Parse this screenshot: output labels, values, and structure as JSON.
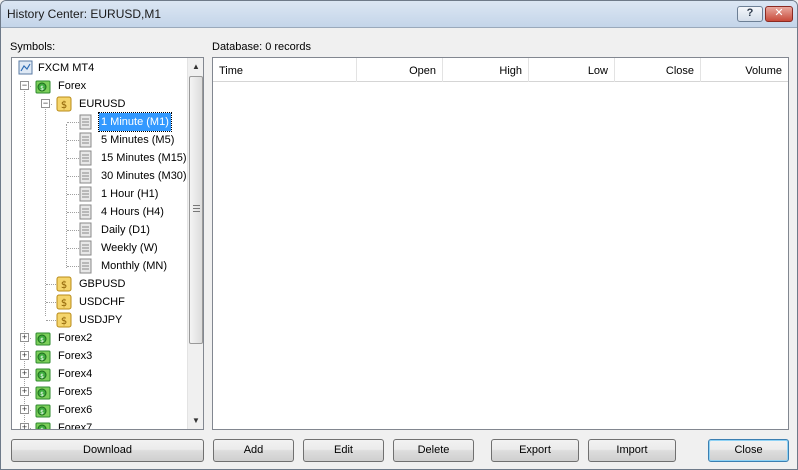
{
  "window": {
    "title": "History Center: EURUSD,M1"
  },
  "titlebar": {
    "help_label": "?",
    "close_label": "✕"
  },
  "symbols_label": "Symbols:",
  "database_label": "Database: 0 records",
  "tree": {
    "root": "FXCM MT4",
    "forex": "Forex",
    "eurusd": "EURUSD",
    "timeframes": [
      "1 Minute (M1)",
      "5 Minutes (M5)",
      "15 Minutes (M15)",
      "30 Minutes (M30)",
      "1 Hour (H1)",
      "4 Hours (H4)",
      "Daily (D1)",
      "Weekly (W)",
      "Monthly (MN)"
    ],
    "symbols": [
      "GBPUSD",
      "USDCHF",
      "USDJPY"
    ],
    "groups": [
      "Forex2",
      "Forex3",
      "Forex4",
      "Forex5",
      "Forex6",
      "Forex7"
    ],
    "selected": "1 Minute (M1)"
  },
  "grid": {
    "columns": [
      "Time",
      "Open",
      "High",
      "Low",
      "Close",
      "Volume"
    ],
    "rows": []
  },
  "buttons": {
    "download": "Download",
    "add": "Add",
    "edit": "Edit",
    "delete": "Delete",
    "export": "Export",
    "import": "Import",
    "close": "Close"
  },
  "colors": {
    "selection": "#3399ff",
    "folder_green": "#3fae3f",
    "coin_gold": "#e8b73a"
  }
}
